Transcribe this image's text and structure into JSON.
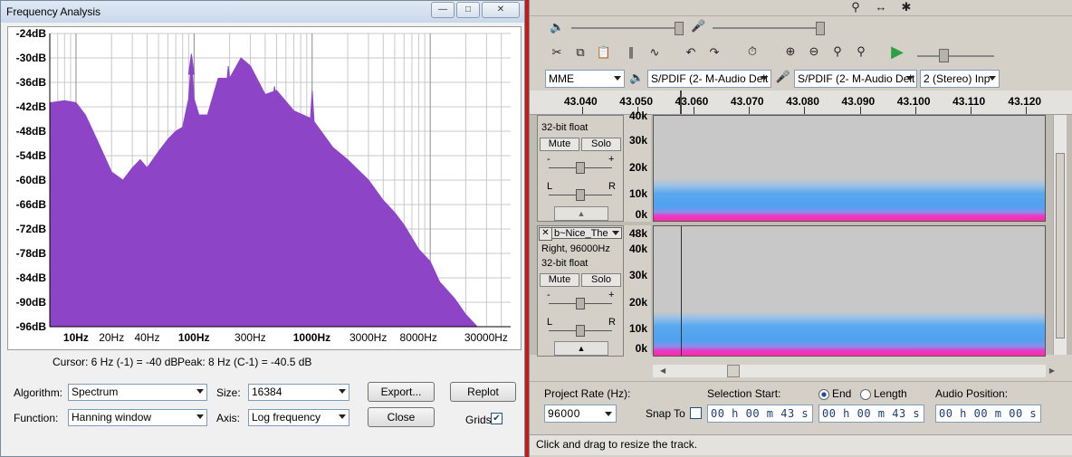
{
  "freq_window": {
    "title": "Frequency Analysis",
    "cursor_text": "Cursor: 6 Hz (-1) = -40 dB",
    "peak_text": "Peak: 8 Hz (C-1) = -40.5 dB",
    "algorithm_label": "Algorithm:",
    "algorithm_value": "Spectrum",
    "size_label": "Size:",
    "size_value": "16384",
    "function_label": "Function:",
    "function_value": "Hanning window",
    "axis_label": "Axis:",
    "axis_value": "Log frequency",
    "export_label": "Export...",
    "replot_label": "Replot",
    "close_label": "Close",
    "grids_label": "Grids",
    "grids_checked": true,
    "spectrum_color": "#8e44c6"
  },
  "chart_data": {
    "type": "area",
    "x_scale": "log",
    "grid": true,
    "ylim": [
      -96,
      -24
    ],
    "xlim": [
      6,
      48000
    ],
    "y_ticks": [
      "-24dB",
      "-30dB",
      "-36dB",
      "-42dB",
      "-48dB",
      "-54dB",
      "-60dB",
      "-66dB",
      "-72dB",
      "-78dB",
      "-84dB",
      "-90dB",
      "-96dB"
    ],
    "x_ticks": [
      {
        "label": "10Hz",
        "value": 10,
        "bold": true
      },
      {
        "label": "20Hz",
        "value": 20,
        "bold": false
      },
      {
        "label": "40Hz",
        "value": 40,
        "bold": false
      },
      {
        "label": "100Hz",
        "value": 100,
        "bold": true
      },
      {
        "label": "300Hz",
        "value": 300,
        "bold": false
      },
      {
        "label": "1000Hz",
        "value": 1000,
        "bold": true
      },
      {
        "label": "3000Hz",
        "value": 3000,
        "bold": false
      },
      {
        "label": "8000Hz",
        "value": 8000,
        "bold": false
      },
      {
        "label": "30000Hz",
        "value": 30000,
        "bold": false
      }
    ],
    "x": [
      6,
      8,
      10,
      12,
      15,
      20,
      25,
      30,
      35,
      40,
      50,
      60,
      70,
      80,
      90,
      95,
      100,
      110,
      130,
      160,
      200,
      250,
      300,
      400,
      500,
      700,
      1000,
      1500,
      2000,
      3000,
      4000,
      5000,
      6000,
      8000,
      10000,
      12000,
      16000,
      20000,
      25000
    ],
    "values": [
      -41,
      -40.5,
      -41,
      -44,
      -50,
      -58,
      -60,
      -57,
      -55,
      -57,
      -53,
      -50,
      -48,
      -47,
      -40,
      -30,
      -40,
      -44,
      -44,
      -35,
      -35,
      -30,
      -32,
      -39,
      -38,
      -43,
      -45,
      -52,
      -55,
      -60,
      -65,
      -68,
      -71,
      -77,
      -80,
      -85,
      -89,
      -93,
      -96
    ],
    "peaks": [
      {
        "x": 95,
        "y": -29
      },
      {
        "x": 158,
        "y": -38
      },
      {
        "x": 195,
        "y": -32
      },
      {
        "x": 240,
        "y": -32
      },
      {
        "x": 290,
        "y": -35
      },
      {
        "x": 380,
        "y": -40
      },
      {
        "x": 480,
        "y": -37
      },
      {
        "x": 650,
        "y": -42
      },
      {
        "x": 1000,
        "y": -38
      },
      {
        "x": 1500,
        "y": -52
      },
      {
        "x": 2000,
        "y": -55
      },
      {
        "x": 3000,
        "y": -63
      }
    ]
  },
  "audacity": {
    "device_host": "MME",
    "playback_device": "S/PDIF (2- M-Audio Delt",
    "recording_device": "S/PDIF (2- M-Audio Delt",
    "channels": "2 (Stereo) Inp",
    "ruler_ticks": [
      "43.040",
      "43.050",
      "43.060",
      "43.070",
      "43.080",
      "43.090",
      "43.100",
      "43.110",
      "43.120"
    ],
    "track1": {
      "format": "32-bit float",
      "mute": "Mute",
      "solo": "Solo",
      "gain_minus": "-",
      "gain_plus": "+",
      "pan_left": "L",
      "pan_right": "R",
      "scale": [
        "30k",
        "20k",
        "10k",
        "0k"
      ],
      "scale_top": "40k"
    },
    "track2": {
      "name": "b~Nice_The",
      "rate_line": "Right, 96000Hz",
      "format": "32-bit float",
      "mute": "Mute",
      "solo": "Solo",
      "gain_minus": "-",
      "gain_plus": "+",
      "pan_left": "L",
      "pan_right": "R",
      "scale_top": "48k",
      "scale": [
        "40k",
        "30k",
        "20k",
        "10k",
        "0k"
      ]
    },
    "project_rate_label": "Project Rate (Hz):",
    "project_rate_value": "96000",
    "snap_to_label": "Snap To",
    "selection_start_label": "Selection Start:",
    "end_label": "End",
    "length_label": "Length",
    "audio_position_label": "Audio Position:",
    "selection_start_value": "00 h 00 m 43 s",
    "end_value": "00 h 00 m 43 s",
    "audio_position_value": "00 h 00 m 00 s",
    "status_text": "Click and drag to resize the track."
  }
}
